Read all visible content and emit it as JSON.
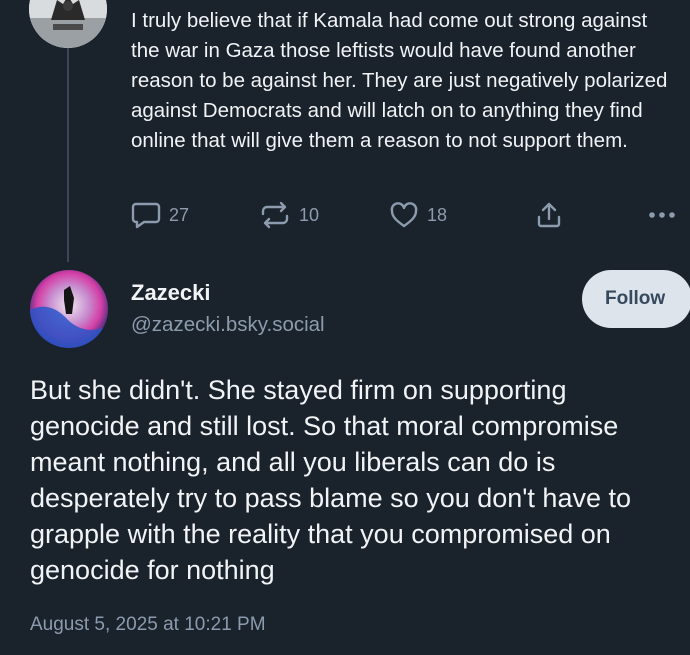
{
  "parent_post": {
    "text": "I truly believe that if Kamala had come out strong against the war in Gaza those leftists would have found another reason to be against her. They are just negatively polarized against Democrats and will latch on to anything they find online that will give them a reason to not support them.",
    "reply_count": "27",
    "repost_count": "10",
    "like_count": "18"
  },
  "reply_post": {
    "display_name": "Zazecki",
    "handle": "@zazecki.bsky.social",
    "follow_label": "Follow",
    "text": "But she didn't. She stayed firm on supporting genocide and still lost. So that moral compromise meant nothing, and all you liberals can do is desperately try to pass blame so you don't have to grapple with the reality that you compromised on genocide for nothing",
    "timestamp": "August 5, 2025 at 10:21 PM"
  },
  "icons": [
    "reply-icon",
    "repost-icon",
    "like-icon",
    "share-icon",
    "more-icon"
  ],
  "colors": {
    "background": "#1a222c",
    "text_primary": "#f1f3f5",
    "text_secondary": "#8c9bad",
    "follow_button_bg": "#dde4ec",
    "follow_button_text": "#36495d"
  }
}
